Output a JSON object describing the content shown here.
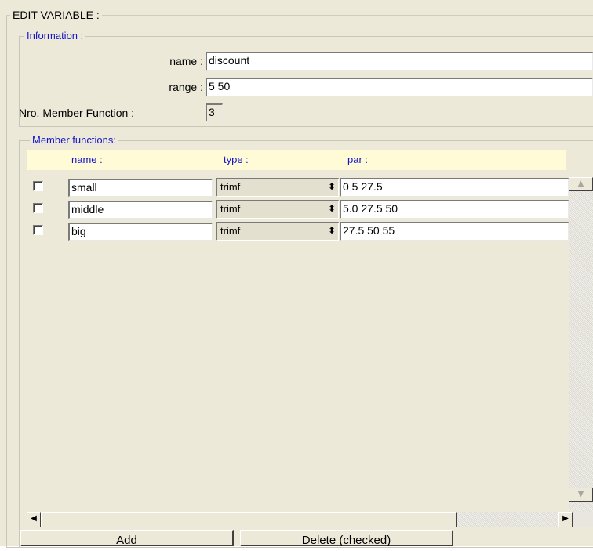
{
  "edit_variable": {
    "title": "EDIT VARIABLE :",
    "information": {
      "legend": "Information :",
      "name_label": "name :",
      "name_value": "discount",
      "range_label": "range :",
      "range_value": "5 50",
      "nro_label": "Nro. Member Function :",
      "nro_value": "3"
    },
    "member_functions": {
      "legend": "Member functions:",
      "columns": {
        "name": "name :",
        "type": "type :",
        "par": "par :"
      },
      "rows": [
        {
          "checked": false,
          "name": "small",
          "type": "trimf",
          "par": "0 5 27.5"
        },
        {
          "checked": false,
          "name": "middle",
          "type": "trimf",
          "par": "5.0 27.5 50"
        },
        {
          "checked": false,
          "name": "big",
          "type": "trimf",
          "par": "27.5 50 55"
        }
      ]
    },
    "buttons": {
      "add": "Add",
      "delete": "Delete (checked)"
    }
  },
  "icons": {
    "spin": "spinner-icon",
    "scroll_up": "scroll-up-icon",
    "scroll_down": "scroll-down-icon",
    "scroll_left": "scroll-left-icon",
    "scroll_right": "scroll-right-icon"
  },
  "colors": {
    "panel": "#ece9d8",
    "legend_blue": "#1414c8",
    "header_bg": "#fffbd6"
  }
}
